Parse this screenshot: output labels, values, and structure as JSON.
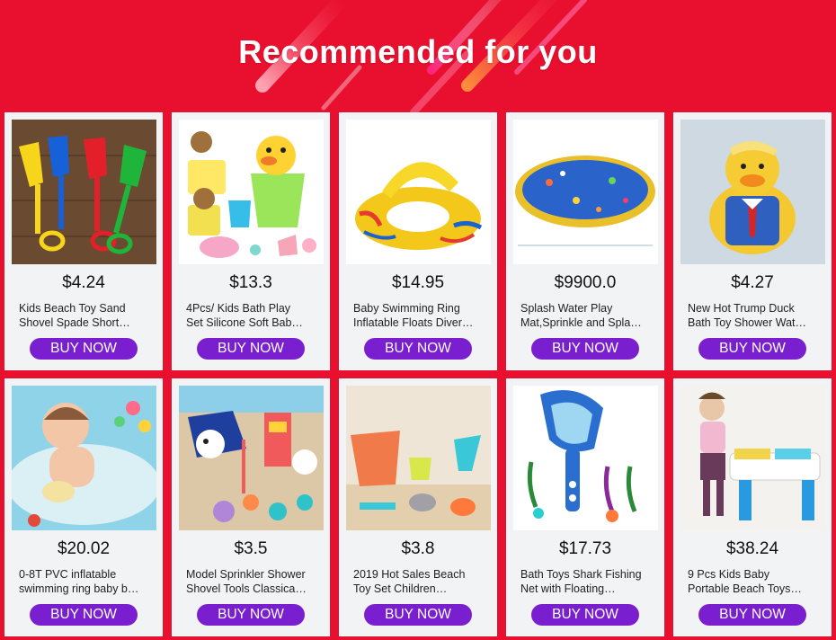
{
  "header": {
    "title": "Recommended for you"
  },
  "colors": {
    "background": "#e8102e",
    "button": "#7a1fd0",
    "card": "#f2f3f5"
  },
  "products": [
    {
      "price": "$4.24",
      "title_line1": "Kids Beach Toy Sand",
      "title_line2": "Shovel Spade Short…",
      "button": "BUY NOW",
      "image": "beach-shovels-image"
    },
    {
      "price": "$13.3",
      "title_line1": "4Pcs/ Kids Bath Play",
      "title_line2": "Set Silicone Soft Bab…",
      "button": "BUY NOW",
      "image": "bath-play-set-image"
    },
    {
      "price": "$14.95",
      "title_line1": "Baby Swimming Ring",
      "title_line2": "Inflatable Floats Diver…",
      "button": "BUY NOW",
      "image": "swim-float-image"
    },
    {
      "price": "$9900.0",
      "title_line1": "Splash Water Play",
      "title_line2": "Mat,Sprinkle and Spla…",
      "button": "BUY NOW",
      "image": "splash-mat-image"
    },
    {
      "price": "$4.27",
      "title_line1": "New Hot Trump Duck",
      "title_line2": "Bath Toy Shower Wat…",
      "button": "BUY NOW",
      "image": "duck-toy-image"
    },
    {
      "price": "$20.02",
      "title_line1": "0-8T PVC inflatable",
      "title_line2": "swimming ring baby b…",
      "button": "BUY NOW",
      "image": "baby-swim-ring-image"
    },
    {
      "price": "$3.5",
      "title_line1": "Model Sprinkler Shower",
      "title_line2": "Shovel Tools Classica…",
      "button": "BUY NOW",
      "image": "sand-tools-image"
    },
    {
      "price": "$3.8",
      "title_line1": "2019 Hot Sales Beach",
      "title_line2": "Toy Set Children…",
      "button": "BUY NOW",
      "image": "beach-toy-set-image"
    },
    {
      "price": "$17.73",
      "title_line1": "Bath Toys Shark Fishing",
      "title_line2": "Net with Floating…",
      "button": "BUY NOW",
      "image": "shark-net-image"
    },
    {
      "price": "$38.24",
      "title_line1": "9 Pcs Kids Baby",
      "title_line2": "Portable Beach Toys…",
      "button": "BUY NOW",
      "image": "sand-table-image"
    }
  ]
}
